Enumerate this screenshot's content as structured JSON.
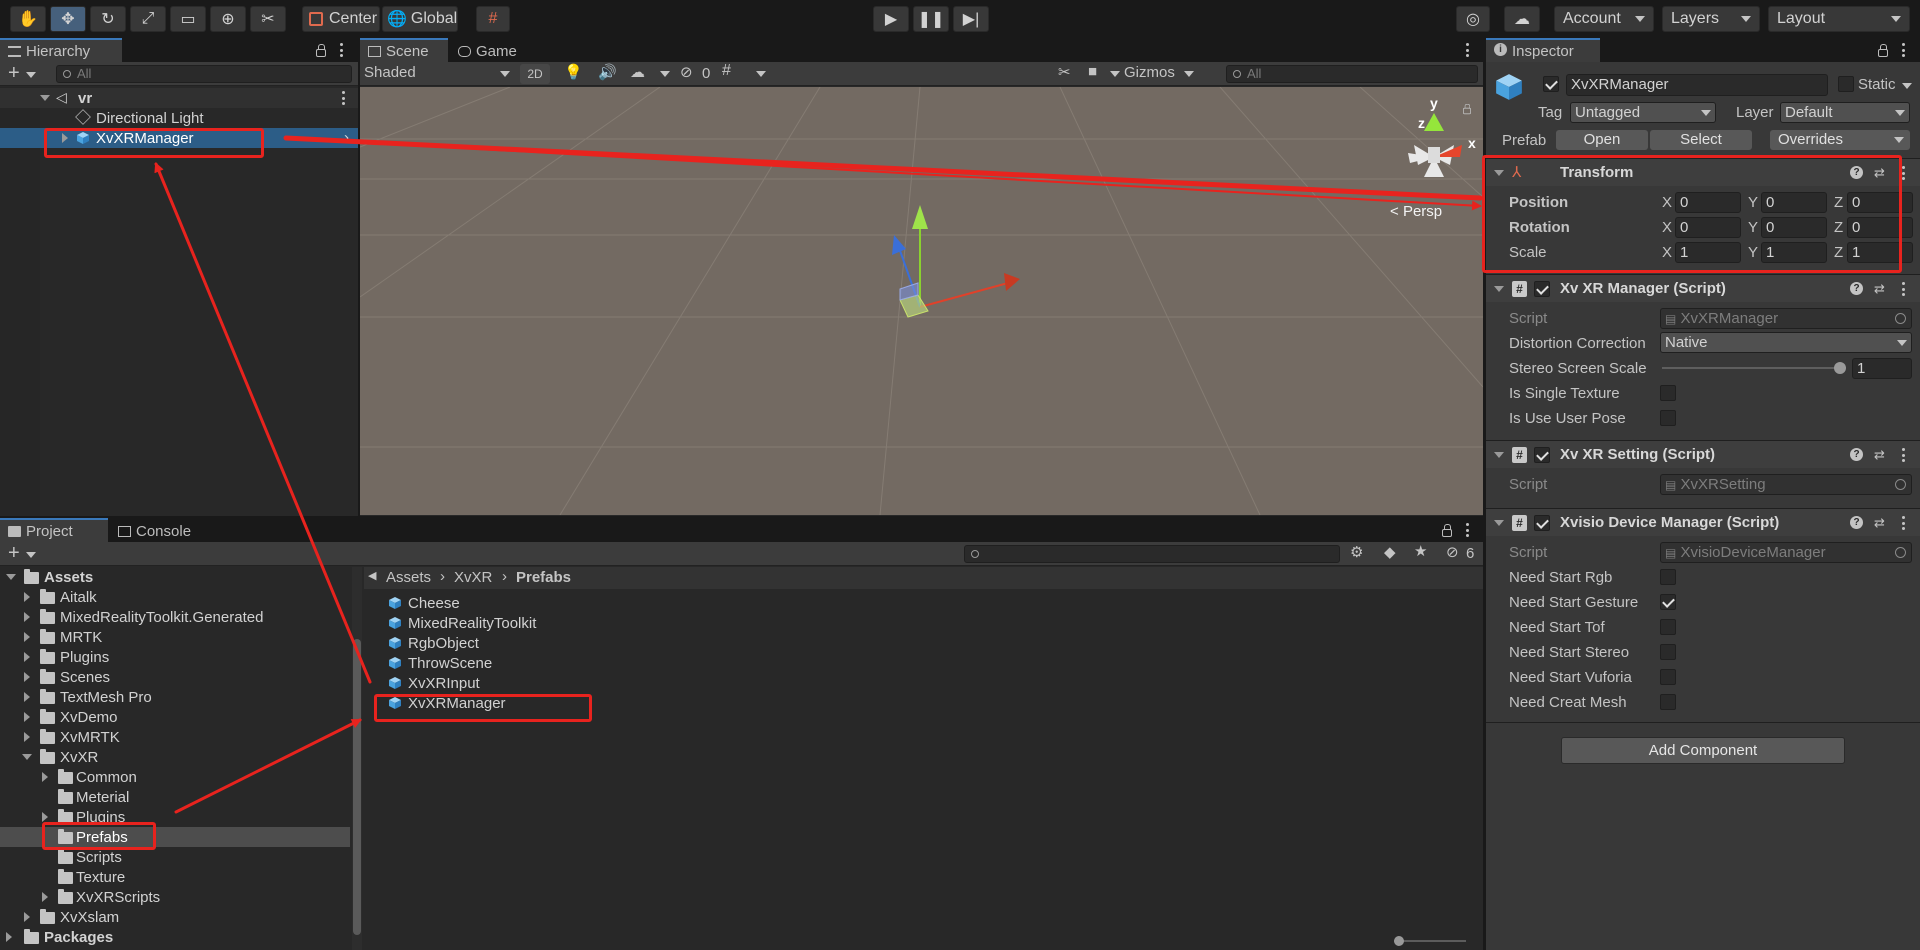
{
  "toolbar": {
    "pivot_label": "Center",
    "space_label": "Global",
    "account_label": "Account",
    "layers_label": "Layers",
    "layout_label": "Layout"
  },
  "hierarchy": {
    "tab_label": "Hierarchy",
    "search_placeholder": "All",
    "scene_name": "vr",
    "items": [
      {
        "label": "Directional Light"
      },
      {
        "label": "XvXRManager"
      }
    ]
  },
  "scene": {
    "tabs": [
      {
        "label": "Scene"
      },
      {
        "label": "Game"
      }
    ],
    "shading_mode": "Shaded",
    "mode_2d": "2D",
    "hidden_count": "0",
    "gizmos_label": "Gizmos",
    "search_placeholder": "All",
    "projection_label": "Persp",
    "axis_y": "y",
    "axis_x": "x",
    "axis_z": "z"
  },
  "project": {
    "tabs": [
      {
        "label": "Project"
      },
      {
        "label": "Console"
      }
    ],
    "hidden_count": "6",
    "breadcrumb": [
      "Assets",
      "XvXR",
      "Prefabs"
    ],
    "tree": [
      {
        "label": "Assets"
      },
      {
        "label": "Aitalk"
      },
      {
        "label": "MixedRealityToolkit.Generated"
      },
      {
        "label": "MRTK"
      },
      {
        "label": "Plugins"
      },
      {
        "label": "Scenes"
      },
      {
        "label": "TextMesh Pro"
      },
      {
        "label": "XvDemo"
      },
      {
        "label": "XvMRTK"
      },
      {
        "label": "XvXR"
      },
      {
        "label": "Common"
      },
      {
        "label": "Meterial"
      },
      {
        "label": "Plugins"
      },
      {
        "label": "Prefabs"
      },
      {
        "label": "Scripts"
      },
      {
        "label": "Texture"
      },
      {
        "label": "XvXRScripts"
      },
      {
        "label": "XvXslam"
      },
      {
        "label": "Packages"
      }
    ],
    "assets": [
      {
        "label": "Cheese"
      },
      {
        "label": "MixedRealityToolkit"
      },
      {
        "label": "RgbObject"
      },
      {
        "label": "ThrowScene"
      },
      {
        "label": "XvXRInput"
      },
      {
        "label": "XvXRManager"
      }
    ]
  },
  "inspector": {
    "tab_label": "Inspector",
    "object_name": "XvXRManager",
    "static_label": "Static",
    "tag_label": "Tag",
    "tag_value": "Untagged",
    "layer_label": "Layer",
    "layer_value": "Default",
    "prefab_label": "Prefab",
    "open_label": "Open",
    "select_label": "Select",
    "overrides_label": "Overrides",
    "transform": {
      "title": "Transform",
      "position_label": "Position",
      "rotation_label": "Rotation",
      "scale_label": "Scale",
      "axis_x": "X",
      "axis_y": "Y",
      "axis_z": "Z",
      "position": {
        "x": "0",
        "y": "0",
        "z": "0"
      },
      "rotation": {
        "x": "0",
        "y": "0",
        "z": "0"
      },
      "scale": {
        "x": "1",
        "y": "1",
        "z": "1"
      }
    },
    "xr_manager": {
      "title": "Xv XR Manager (Script)",
      "script_label": "Script",
      "script_value": "XvXRManager",
      "distortion_label": "Distortion Correction",
      "distortion_value": "Native",
      "stereo_label": "Stereo Screen Scale",
      "stereo_value": "1",
      "stereo_slider_fraction": 1.0,
      "single_texture_label": "Is Single Texture",
      "single_texture": false,
      "user_pose_label": "Is Use User Pose",
      "user_pose": false
    },
    "xr_setting": {
      "title": "Xv XR Setting (Script)",
      "script_label": "Script",
      "script_value": "XvXRSetting"
    },
    "device_manager": {
      "title": "Xvisio Device Manager (Script)",
      "script_label": "Script",
      "script_value": "XvisioDeviceManager",
      "options": [
        {
          "label": "Need Start Rgb",
          "checked": false
        },
        {
          "label": "Need Start Gesture",
          "checked": true
        },
        {
          "label": "Need Start Tof",
          "checked": false
        },
        {
          "label": "Need Start Stereo",
          "checked": false
        },
        {
          "label": "Need Start Vuforia",
          "checked": false
        },
        {
          "label": "Need Creat Mesh",
          "checked": false
        }
      ]
    },
    "add_component_label": "Add Component"
  },
  "colors": {
    "accent_blue": "#2c5d87",
    "annotation_red": "#e8231e",
    "scene_bg": "#736a62"
  }
}
